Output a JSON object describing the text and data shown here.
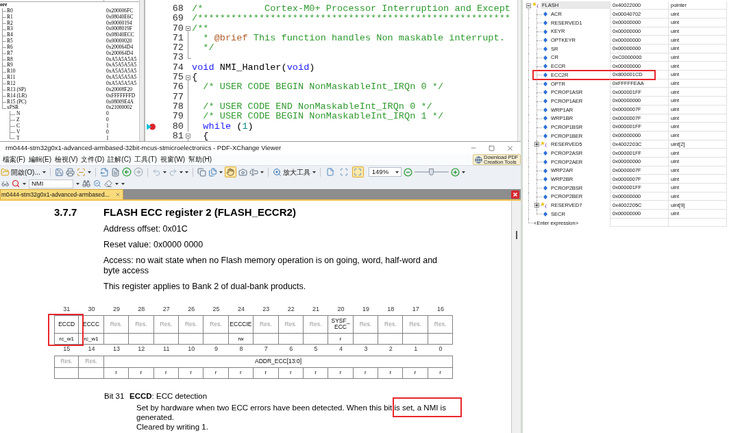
{
  "registers_panel": {
    "root": {
      "label": "ore",
      "children": [
        {
          "name": "R0",
          "value": "0x200006FC"
        },
        {
          "name": "R1",
          "value": "0x08040E6C"
        },
        {
          "name": "R2",
          "value": "0x00000194"
        },
        {
          "name": "R3",
          "value": "0x0008019F"
        },
        {
          "name": "R4",
          "value": "0x08040ECC"
        },
        {
          "name": "R5",
          "value": "0x00000020"
        },
        {
          "name": "R6",
          "value": "0x200064D4"
        },
        {
          "name": "R7",
          "value": "0x200064D4"
        },
        {
          "name": "R8",
          "value": "0xA5A5A5A5"
        },
        {
          "name": "R9",
          "value": "0xA5A5A5A5"
        },
        {
          "name": "R10",
          "value": "0xA5A5A5A5"
        },
        {
          "name": "R11",
          "value": "0xA5A5A5A5"
        },
        {
          "name": "R12",
          "value": "0xA5A5A5A5"
        },
        {
          "name": "R13 (SP)",
          "value": "0x20008F20"
        },
        {
          "name": "R14 (LR)",
          "value": "0xFFFFFFFD"
        },
        {
          "name": "R15 (PC)",
          "value": "0x08009E4A"
        },
        {
          "name": "xPSR",
          "value": "0x21000002",
          "children": [
            {
              "name": "N",
              "value": "0"
            },
            {
              "name": "Z",
              "value": "0"
            },
            {
              "name": "C",
              "value": "1"
            },
            {
              "name": "V",
              "value": "0"
            },
            {
              "name": "T",
              "value": "1"
            }
          ]
        }
      ]
    }
  },
  "code_editor": {
    "lines": [
      {
        "number": "68",
        "kind": "plain",
        "current": false,
        "tokens": [
          {
            "kind": "comment",
            "text": "/*           Cortex-M0+ Processor Interruption and Except"
          }
        ]
      },
      {
        "number": "69",
        "kind": "plain",
        "current": false,
        "tokens": [
          {
            "kind": "comment",
            "text": "/********************************************************"
          }
        ]
      },
      {
        "number": "70",
        "kind": "foldstart",
        "current": false,
        "tokens": [
          {
            "kind": "comment",
            "text": "/**"
          }
        ]
      },
      {
        "number": "71",
        "kind": "foldbody",
        "current": false,
        "tokens": [
          {
            "kind": "comment",
            "text": "  * "
          },
          {
            "kind": "doc_tag",
            "text": "@brief"
          },
          {
            "kind": "comment",
            "text": " This function handles Non maskable interrupt."
          }
        ]
      },
      {
        "number": "72",
        "kind": "foldbody",
        "current": false,
        "tokens": [
          {
            "kind": "comment",
            "text": "  */"
          }
        ]
      },
      {
        "number": "73",
        "kind": "foldend",
        "current": false
      },
      {
        "number": "74",
        "kind": "plain",
        "current": false,
        "tokens": [
          {
            "kind": "keyword",
            "text": "void"
          },
          {
            "kind": "plain",
            "text": " NMI_Handler("
          },
          {
            "kind": "keyword",
            "text": "void"
          },
          {
            "kind": "plain",
            "text": ")"
          }
        ]
      },
      {
        "number": "75",
        "kind": "foldstart",
        "current": false,
        "tokens": [
          {
            "kind": "plain",
            "text": "{"
          }
        ]
      },
      {
        "number": "76",
        "kind": "foldbody",
        "current": false,
        "tokens": [
          {
            "kind": "comment",
            "text": "  /* USER CODE BEGIN NonMaskableInt_IRQn 0 */"
          }
        ]
      },
      {
        "number": "77",
        "kind": "foldbody",
        "current": false
      },
      {
        "number": "78",
        "kind": "foldbody",
        "current": false,
        "tokens": [
          {
            "kind": "comment",
            "text": "  /* USER CODE END NonMaskableInt_IRQn 0 */"
          }
        ]
      },
      {
        "number": "79",
        "kind": "foldbody",
        "current": false,
        "tokens": [
          {
            "kind": "comment",
            "text": "  /* USER CODE BEGIN NonMaskableInt_IRQn 1 */"
          }
        ]
      },
      {
        "number": "80",
        "kind": "foldbody",
        "current": true,
        "tokens": [
          {
            "kind": "keyword",
            "text": "  while"
          },
          {
            "kind": "plain",
            "text": " ("
          },
          {
            "kind": "number",
            "text": "1"
          },
          {
            "kind": "plain",
            "text": ")"
          }
        ]
      },
      {
        "number": "81",
        "kind": "foldstart",
        "current": false,
        "tokens": [
          {
            "kind": "plain",
            "text": "  {"
          }
        ]
      }
    ]
  },
  "pdf_viewer": {
    "title": "rm0444-stm32g0x1-advanced-armbased-32bit-mcus-stmicroelectronics - PDF-XChange Viewer",
    "menu": [
      "檔案(F)",
      "編輯(E)",
      "檢視(V)",
      "文件(D)",
      "註解(C)",
      "工具(T)",
      "視窗(W)",
      "幫助(H)"
    ],
    "promo_button": {
      "lines": [
        "Download PDF",
        "Creation Tools"
      ]
    },
    "toolbar": {
      "open_label": "開啟(O)...",
      "hand_tool": {
        "selected": true
      },
      "zoom_tool_label": "放大工具",
      "page_fit_buttons": [
        {
          "selected": false
        },
        {
          "selected": false
        },
        {
          "selected": true
        }
      ],
      "zoom_value": "149%",
      "zoom_slider": {
        "level": 0.5
      }
    },
    "search_field": {
      "value": "NMI"
    },
    "tabs": [
      {
        "label": "m0444-stm32g0x1-advanced-armbased...",
        "selected": true
      }
    ],
    "document": {
      "section_number": "3.7.7",
      "section_title": "FLASH ECC register 2 (FLASH_ECCR2)",
      "paragraphs": [
        "Address offset: 0x01C",
        "Reset value: 0x0000 0000",
        "Access: no wait state when no Flash memory operation is on going, word, half-word and byte access",
        "This register applies to Bank 2 of dual-bank products."
      ],
      "register_rows": [
        {
          "bit_numbers": [
            "31",
            "30",
            "29",
            "28",
            "27",
            "26",
            "25",
            "24",
            "23",
            "22",
            "21",
            "20",
            "19",
            "18",
            "17",
            "16"
          ],
          "fields": [
            {
              "name": "ECCD",
              "reserved": false,
              "access": [
                "rc_w1"
              ],
              "highlighted": true
            },
            {
              "name": "ECCC",
              "reserved": false,
              "access": [
                "rc_w1"
              ],
              "highlighted": false
            },
            {
              "name": "Res.",
              "reserved": true,
              "highlighted": false
            },
            {
              "name": "Res.",
              "reserved": true,
              "highlighted": false
            },
            {
              "name": "Res.",
              "reserved": true,
              "highlighted": false
            },
            {
              "name": "Res.",
              "reserved": true,
              "highlighted": false
            },
            {
              "name": "Res.",
              "reserved": true,
              "highlighted": false
            },
            {
              "name": "ECCCIE",
              "reserved": false,
              "access": [
                "rw"
              ],
              "highlighted": false
            },
            {
              "name": "Res.",
              "reserved": true,
              "highlighted": false
            },
            {
              "name": "Res.",
              "reserved": true,
              "highlighted": false
            },
            {
              "name": "Res.",
              "reserved": true,
              "highlighted": false
            },
            {
              "name": "SYSF_\nECC",
              "reserved": false,
              "access": [
                "r"
              ],
              "highlighted": false
            },
            {
              "name": "Res.",
              "reserved": true,
              "highlighted": false
            },
            {
              "name": "Res.",
              "reserved": true,
              "highlighted": false
            },
            {
              "name": "Res.",
              "reserved": true,
              "highlighted": false
            },
            {
              "name": "Res.",
              "reserved": true,
              "highlighted": false
            }
          ]
        },
        {
          "bit_numbers": [
            "15",
            "14",
            "13",
            "12",
            "11",
            "10",
            "9",
            "8",
            "7",
            "6",
            "5",
            "4",
            "3",
            "2",
            "1",
            "0"
          ],
          "fields": [
            {
              "name": "Res.",
              "reserved": true,
              "highlighted": false
            },
            {
              "name": "Res.",
              "reserved": true,
              "highlighted": false
            },
            {
              "name": "ADDR_ECC[13:0]",
              "reserved": false,
              "access": [
                "r",
                "r",
                "r",
                "r",
                "r",
                "r",
                "r",
                "r",
                "r",
                "r",
                "r",
                "r",
                "r",
                "r"
              ],
              "highlighted": false
            }
          ]
        }
      ],
      "bit_description": {
        "bit": "Bit 31",
        "title": "**ECCD**: ECC detection",
        "text": "Set by hardware when two ECC errors have been detected. When this bit is set, a NMI is generated.",
        "highlighted": true,
        "note": "Cleared by writing 1."
      }
    }
  },
  "watch": {
    "root": {
      "name": "FLASH",
      "value": "0x40022000",
      "type": "pointer",
      "kind": "struct",
      "expanded": true,
      "highlighted": false,
      "children": [
        {
          "name": "ACR",
          "value": "0x00040702",
          "type": "uint",
          "kind": "field",
          "highlighted": false
        },
        {
          "name": "RESERVED1",
          "value": "0x00000000",
          "type": "uint",
          "kind": "field",
          "highlighted": false
        },
        {
          "name": "KEYR",
          "value": "0x00000000",
          "type": "uint",
          "kind": "field",
          "highlighted": false
        },
        {
          "name": "OPTKEYR",
          "value": "0x00000000",
          "type": "uint",
          "kind": "field",
          "highlighted": false
        },
        {
          "name": "SR",
          "value": "0x00000000",
          "type": "uint",
          "kind": "field",
          "highlighted": false
        },
        {
          "name": "CR",
          "value": "0xC0000000",
          "type": "uint",
          "kind": "field",
          "highlighted": false
        },
        {
          "name": "ECCR",
          "value": "0x00000000",
          "type": "uint",
          "kind": "field",
          "highlighted": false
        },
        {
          "name": "ECC2R",
          "value": "0x800001CD",
          "type": "uint",
          "kind": "field",
          "highlighted": true
        },
        {
          "name": "OPTR",
          "value": "0xFFFFFEAA",
          "type": "uint",
          "kind": "field",
          "highlighted": false
        },
        {
          "name": "PCROP1ASR",
          "value": "0x000001FF",
          "type": "uint",
          "kind": "field",
          "highlighted": false
        },
        {
          "name": "PCROP1AER",
          "value": "0x00000000",
          "type": "uint",
          "kind": "field",
          "highlighted": false
        },
        {
          "name": "WRP1AR",
          "value": "0x0000007F",
          "type": "uint",
          "kind": "field",
          "highlighted": false
        },
        {
          "name": "WRP1BR",
          "value": "0x0000007F",
          "type": "uint",
          "kind": "field",
          "highlighted": false
        },
        {
          "name": "PCROP1BSR",
          "value": "0x000001FF",
          "type": "uint",
          "kind": "field",
          "highlighted": false
        },
        {
          "name": "PCROP1BER",
          "value": "0x00000000",
          "type": "uint",
          "kind": "field",
          "highlighted": false
        },
        {
          "name": "RESERVED5",
          "value": "0x4002203C",
          "type": "uint[2]",
          "kind": "struct",
          "expanded": false,
          "highlighted": false
        },
        {
          "name": "PCROP2ASR",
          "value": "0x000001FF",
          "type": "uint",
          "kind": "field",
          "highlighted": false
        },
        {
          "name": "PCROP2AER",
          "value": "0x00000000",
          "type": "uint",
          "kind": "field",
          "highlighted": false
        },
        {
          "name": "WRP2AR",
          "value": "0x0000007F",
          "type": "uint",
          "kind": "field",
          "highlighted": false
        },
        {
          "name": "WRP2BR",
          "value": "0x0000007F",
          "type": "uint",
          "kind": "field",
          "highlighted": false
        },
        {
          "name": "PCROP2BSR",
          "value": "0x000001FF",
          "type": "uint",
          "kind": "field",
          "highlighted": false
        },
        {
          "name": "PCROP2BER",
          "value": "0x00000000",
          "type": "uint",
          "kind": "field",
          "highlighted": false
        },
        {
          "name": "RESERVED7",
          "value": "0x4002205C",
          "type": "uint[9]",
          "kind": "struct",
          "expanded": false,
          "highlighted": false
        },
        {
          "name": "SECR",
          "value": "0x00000000",
          "type": "uint",
          "kind": "field",
          "highlighted": false
        }
      ]
    },
    "new_expression": "<Enter expression>"
  }
}
